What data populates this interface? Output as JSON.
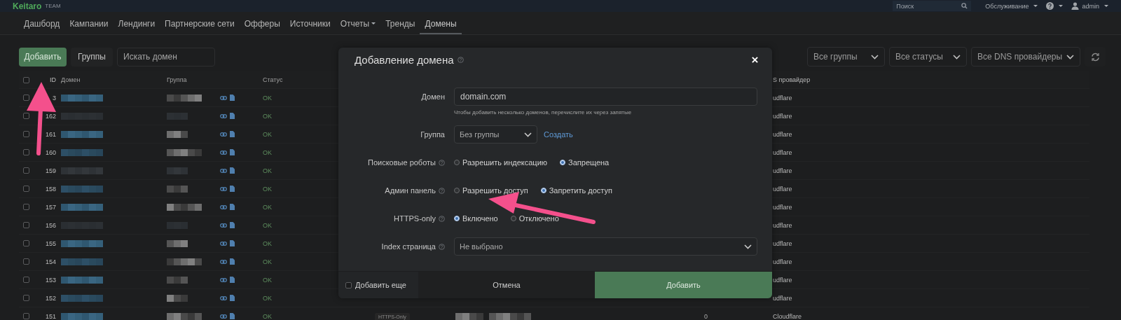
{
  "topbar": {
    "logo": "Keitaro",
    "edition": "TEAM",
    "search": {
      "placeholder": "Поиск"
    },
    "menus": [
      {
        "kind": "text",
        "label": "Обслуживание"
      },
      {
        "kind": "help"
      },
      {
        "kind": "user",
        "label": "admin"
      }
    ]
  },
  "nav": [
    {
      "label": "Дашборд",
      "selected": false,
      "dropdown": false
    },
    {
      "label": "Кампании",
      "selected": false,
      "dropdown": false
    },
    {
      "label": "Лендинги",
      "selected": false,
      "dropdown": false
    },
    {
      "label": "Партнерские сети",
      "selected": false,
      "dropdown": false
    },
    {
      "label": "Офферы",
      "selected": false,
      "dropdown": false
    },
    {
      "label": "Источники",
      "selected": false,
      "dropdown": false
    },
    {
      "label": "Отчеты",
      "selected": false,
      "dropdown": true
    },
    {
      "label": "Тренды",
      "selected": false,
      "dropdown": false
    },
    {
      "label": "Домены",
      "selected": true,
      "dropdown": false
    }
  ],
  "toolbar": {
    "add_button": "Добавить",
    "groups_button": "Группы",
    "search": {
      "placeholder": "Искать домен"
    },
    "filters": [
      "Все группы",
      "Все статусы",
      "Все DNS провайдеры"
    ]
  },
  "table": {
    "header_checked": false,
    "columns": [
      "ID",
      "Домен",
      "Группа",
      "Статус",
      "S провайдер"
    ],
    "rows": [
      {
        "id": "3",
        "checked": false,
        "domain_masked": true,
        "group_masked": true,
        "status": "OK",
        "dns": "udflare"
      },
      {
        "id": "162",
        "checked": false,
        "domain_masked": false,
        "group_masked": false,
        "status": "OK",
        "dns": "udflare"
      },
      {
        "id": "161",
        "checked": false,
        "domain_masked": true,
        "group_masked": true,
        "status": "OK",
        "dns": "udflare"
      },
      {
        "id": "160",
        "checked": false,
        "domain_masked": true,
        "group_masked": true,
        "status": "OK",
        "dns": "udflare"
      },
      {
        "id": "159",
        "checked": false,
        "domain_masked": false,
        "group_masked": false,
        "status": "OK",
        "dns": "udflare"
      },
      {
        "id": "158",
        "checked": false,
        "domain_masked": true,
        "group_masked": true,
        "status": "OK",
        "dns": "udflare"
      },
      {
        "id": "157",
        "checked": false,
        "domain_masked": true,
        "group_masked": true,
        "status": "OK",
        "dns": "udflare"
      },
      {
        "id": "156",
        "checked": false,
        "domain_masked": false,
        "group_masked": false,
        "status": "OK",
        "dns": "udflare"
      },
      {
        "id": "155",
        "checked": false,
        "domain_masked": true,
        "group_masked": true,
        "status": "OK",
        "dns": "udflare"
      },
      {
        "id": "154",
        "checked": false,
        "domain_masked": true,
        "group_masked": true,
        "status": "OK",
        "dns": "udflare"
      },
      {
        "id": "153",
        "checked": false,
        "domain_masked": true,
        "group_masked": true,
        "status": "OK",
        "dns": "udflare"
      },
      {
        "id": "152",
        "checked": false,
        "domain_masked": true,
        "group_masked": true,
        "status": "OK",
        "dns": "udflare"
      },
      {
        "id": "151",
        "checked": false,
        "domain_masked": true,
        "group_masked": true,
        "status": "OK",
        "badge": "HTTPS-Only",
        "column_7_masked": true,
        "column_8": "0",
        "dns": "Cloudflare"
      }
    ]
  },
  "modal": {
    "title": "Добавление домена",
    "fields": [
      {
        "kind": "input",
        "label": "Домен",
        "help": false,
        "value": "domain.com",
        "hint": "Чтобы добавить несколько доменов, перечислите их через запятые"
      },
      {
        "kind": "select",
        "label": "Группа",
        "help": false,
        "value": "Без группы",
        "wide": false,
        "link": "Создать"
      },
      {
        "kind": "radio",
        "label": "Поисковые роботы",
        "help": true,
        "options": [
          {
            "label": "Разрешить индексацию",
            "selected": false
          },
          {
            "label": "Запрещена",
            "selected": true
          }
        ]
      },
      {
        "kind": "radio",
        "label": "Админ панель",
        "help": true,
        "options": [
          {
            "label": "Разрешить доступ",
            "selected": false
          },
          {
            "label": "Запретить доступ",
            "selected": true
          }
        ]
      },
      {
        "kind": "radio",
        "label": "HTTPS-only",
        "help": true,
        "options": [
          {
            "label": "Включено",
            "selected": true
          },
          {
            "label": "Отключено",
            "selected": false
          }
        ]
      },
      {
        "kind": "select",
        "label": "Index страница",
        "help": true,
        "value": "Не выбрано",
        "wide": true
      }
    ],
    "footer": {
      "add_more": {
        "label": "Добавить еще",
        "checked": false
      },
      "cancel": "Отмена",
      "submit": "Добавить"
    }
  }
}
